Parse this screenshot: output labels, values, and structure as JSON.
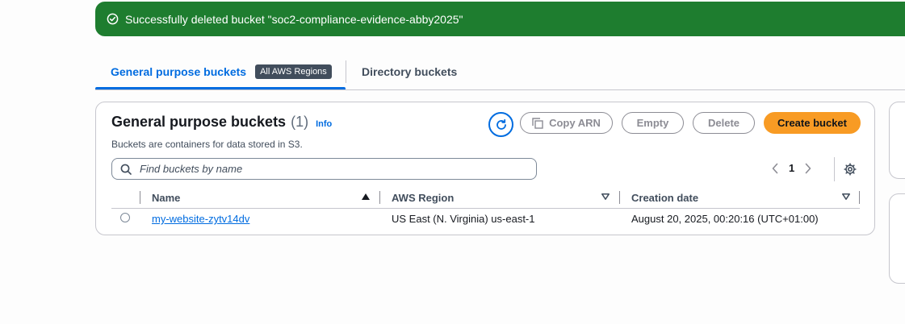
{
  "flash": {
    "message": "Successfully deleted bucket \"soc2-compliance-evidence-abby2025\"",
    "icon": "check-circle-icon",
    "color": "#1e7d2f"
  },
  "tabs": [
    {
      "label": "General purpose buckets",
      "badge": "All AWS Regions",
      "active": true
    },
    {
      "label": "Directory buckets",
      "active": false
    }
  ],
  "panel": {
    "title": "General purpose buckets",
    "count": "(1)",
    "info_link": "Info",
    "description": "Buckets are containers for data stored in S3.",
    "actions": {
      "refresh_icon": "refresh-icon",
      "copy_arn": "Copy ARN",
      "empty": "Empty",
      "delete": "Delete",
      "create": "Create bucket"
    },
    "search": {
      "placeholder": "Find buckets by name",
      "value": ""
    },
    "pagination": {
      "current_page": "1"
    },
    "table": {
      "columns": [
        "Name",
        "AWS Region",
        "Creation date"
      ],
      "rows": [
        {
          "name": "my-website-zytv14dv",
          "region": "US East (N. Virginia) us-east-1",
          "created": "August 20, 2025, 00:20:16 (UTC+01:00)"
        }
      ]
    }
  },
  "colors": {
    "accent": "#006ce0",
    "primary_button": "#f89b24",
    "success": "#1e7d2f"
  }
}
